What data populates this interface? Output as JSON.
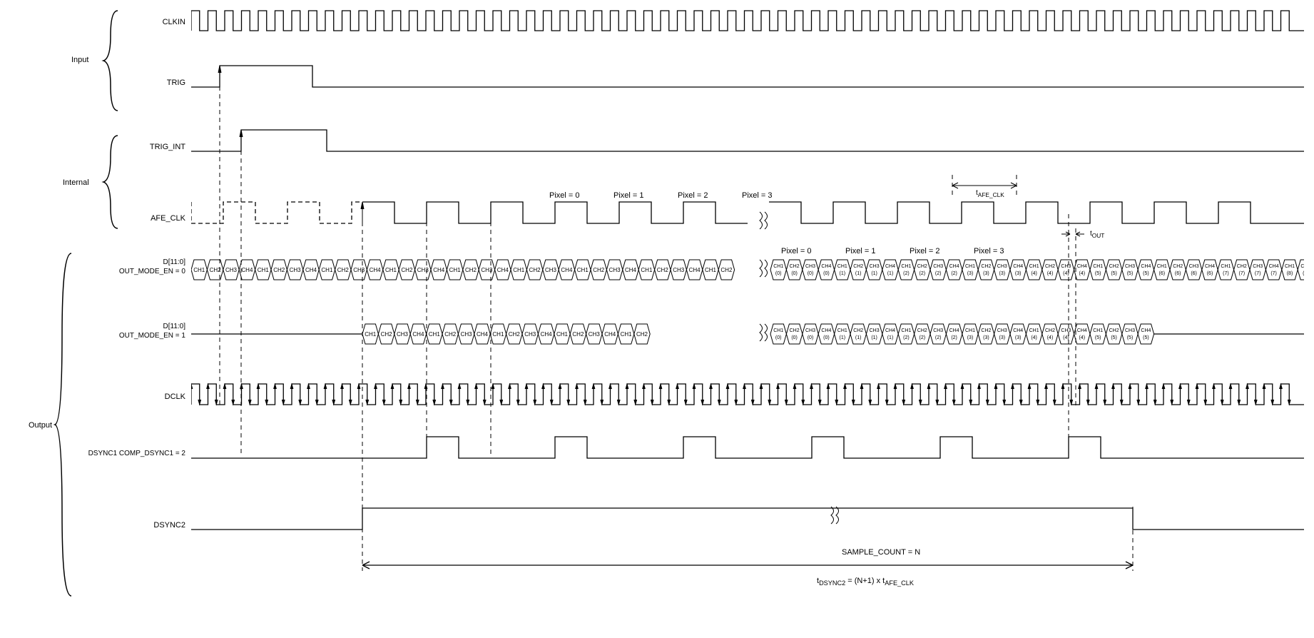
{
  "groups": {
    "input": "Input",
    "internal": "Internal",
    "output": "Output"
  },
  "signals": {
    "clkin": "CLKIN",
    "trig": "TRIG",
    "trig_int": "TRIG_INT",
    "afe_clk": "AFE_CLK",
    "d0_label1": "D[11:0]",
    "d0_label2": "OUT_MODE_EN = 0",
    "d1_label1": "D[11:0]",
    "d1_label2": "OUT_MODE_EN = 1",
    "dclk": "DCLK",
    "dsync1": "DSYNC1 COMP_DSYNC1 = 2",
    "dsync2": "DSYNC2"
  },
  "pixel_labels": {
    "top": [
      "Pixel = 0",
      "Pixel = 1",
      "Pixel = 2",
      "Pixel = 3"
    ],
    "d0": [
      "Pixel = 0",
      "Pixel = 1",
      "Pixel = 2",
      "Pixel = 3"
    ]
  },
  "timing_markers": {
    "t_afe_clk": "t",
    "t_afe_clk_sub": "AFE_CLK",
    "t_out": "t",
    "t_out_sub": "OUT"
  },
  "bottom_annotations": {
    "sample_count": "SAMPLE_COUNT = N",
    "t_dsync2": "t",
    "t_dsync2_sub": "DSYNC2",
    "t_dsync2_eq": " = (N+1) x t",
    "t_dsync2_eq_sub": "AFE_CLK"
  },
  "chart_data": {
    "type": "timing-diagram",
    "clkin_cycles": 66,
    "dclk_cycles": 66,
    "afe_clk_first_valid_pixel": 0,
    "afe_clk_pixels_shown_before_break": 4,
    "d_bus_width": 12,
    "channels": [
      "CH1",
      "CH2",
      "CH3",
      "CH4"
    ],
    "out_mode_en_0_pre_break_groups": 8,
    "out_mode_en_0_post_break_indexed_pixels": [
      0,
      1,
      2,
      3,
      4,
      5,
      6,
      7,
      8
    ],
    "out_mode_en_1_pre_break_groups": 4,
    "out_mode_en_1_pre_break_extra": [
      "CH1",
      "CH2"
    ],
    "out_mode_en_1_post_break_indexed_pixels": [
      0,
      1,
      2,
      3,
      4,
      5
    ],
    "dsync1_comp_dsync1": 2,
    "dsync2_formula": "t_DSYNC2 = (N+1) * t_AFE_CLK"
  }
}
